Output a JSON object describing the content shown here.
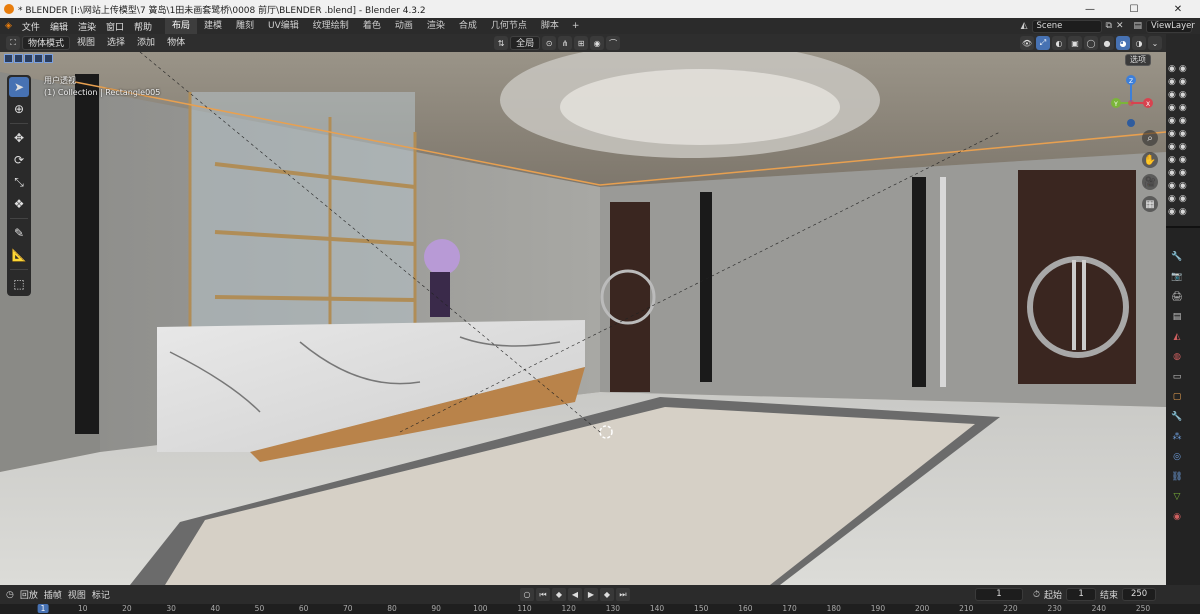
{
  "window": {
    "title": "* BLENDER  [I:\\网站上传模型\\7 簧岛\\1田未画套鹭桥\\0008 前厅\\BLENDER .blend] - Blender 4.3.2",
    "minimize": "—",
    "maximize": "☐",
    "close": "✕"
  },
  "menu": {
    "items": [
      "文件",
      "编辑",
      "渲染",
      "窗口",
      "帮助"
    ],
    "workspaces": [
      "布局",
      "建模",
      "雕刻",
      "UV编辑",
      "纹理绘制",
      "着色",
      "动画",
      "渲染",
      "合成",
      "几何节点",
      "脚本"
    ],
    "active_workspace": "布局",
    "add_workspace": "+",
    "scene": "Scene",
    "view_layer": "ViewLayer"
  },
  "viewport_header": {
    "mode": "物体模式",
    "menus": [
      "视图",
      "选择",
      "添加",
      "物体"
    ],
    "transform_orientation": "全局",
    "options": "选项"
  },
  "viewport": {
    "view_name": "用户透视",
    "collection_info": "(1) Collection | Rectangle005",
    "gizmo_axes": {
      "z": "Z",
      "x": "X",
      "y": "Y"
    }
  },
  "toolbar": {
    "tools": [
      "select-box",
      "cursor",
      "move",
      "rotate",
      "scale",
      "transform",
      "annotate",
      "measure",
      "add-cube"
    ],
    "active_tool": "select-box"
  },
  "timeline": {
    "menus": [
      "回放",
      "插帧",
      "视图",
      "标记"
    ],
    "current_frame": "1",
    "start_label": "起始",
    "start": "1",
    "end_label": "结束",
    "end": "250",
    "ruler": [
      "1",
      "10",
      "20",
      "30",
      "40",
      "50",
      "60",
      "70",
      "80",
      "90",
      "100",
      "110",
      "120",
      "130",
      "140",
      "150",
      "160",
      "170",
      "180",
      "190",
      "200",
      "210",
      "220",
      "230",
      "240",
      "250"
    ]
  },
  "colors": {
    "accent": "#4772b3",
    "x_axis": "#d8434f",
    "y_axis": "#7bb53a",
    "z_axis": "#3d7fd9",
    "blender_orange": "#e87d0d"
  }
}
